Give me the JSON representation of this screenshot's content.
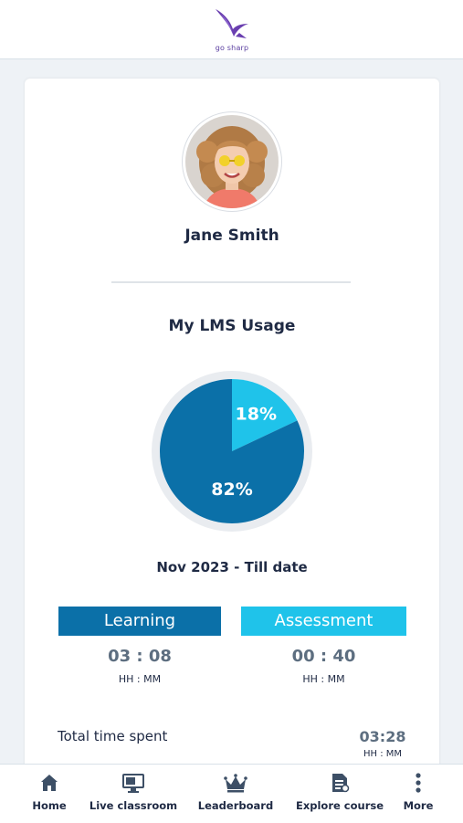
{
  "header": {
    "logo_text": "go sharp",
    "logo_icon": "bird-logo-icon"
  },
  "profile": {
    "name": "Jane Smith",
    "avatar_icon": "user-avatar"
  },
  "usage": {
    "title": "My LMS Usage",
    "period": "Nov 2023 - Till date"
  },
  "chart_data": {
    "type": "pie",
    "title": "My LMS Usage",
    "slices": [
      {
        "name": "Learning",
        "value": 82,
        "label": "82%",
        "color": "#0b70a8"
      },
      {
        "name": "Assessment",
        "value": 18,
        "label": "18%",
        "color": "#1fc3ea"
      }
    ]
  },
  "stats": {
    "learning": {
      "label": "Learning",
      "value": "03 : 08",
      "unit": "HH : MM",
      "color": "#0b70a8"
    },
    "assessment": {
      "label": "Assessment",
      "value": "00 : 40",
      "unit": "HH : MM",
      "color": "#1fc3ea"
    }
  },
  "total": {
    "label": "Total time spent",
    "value": "03:28",
    "unit": "HH : MM"
  },
  "nav": {
    "items": [
      {
        "label": "Home",
        "icon": "home-icon"
      },
      {
        "label": "Live classroom",
        "icon": "monitor-icon"
      },
      {
        "label": "Leaderboard",
        "icon": "crown-icon"
      },
      {
        "label": "Explore course",
        "icon": "document-icon"
      },
      {
        "label": "More",
        "icon": "more-vertical-icon"
      }
    ]
  },
  "colors": {
    "primary": "#0b70a8",
    "accent": "#1fc3ea",
    "text": "#1f2a44",
    "brand": "#5a3ea0"
  }
}
